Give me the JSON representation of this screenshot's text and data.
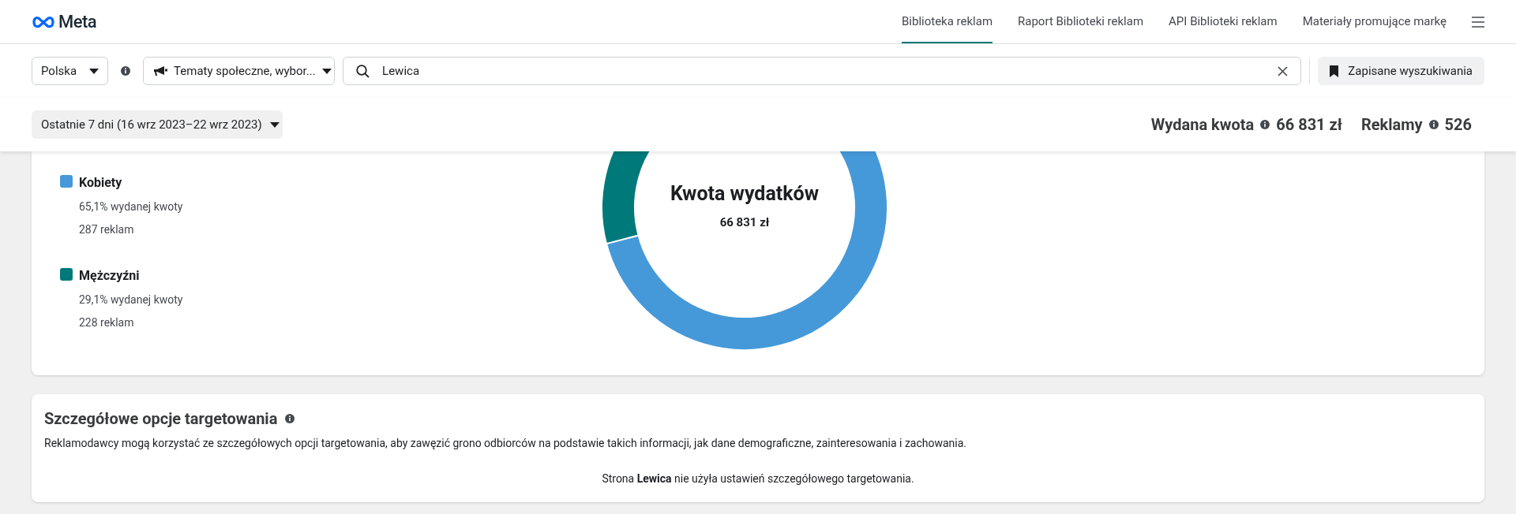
{
  "header": {
    "logo": "Meta",
    "nav": [
      {
        "label": "Biblioteka reklam",
        "selected": true
      },
      {
        "label": "Raport Biblioteki reklam",
        "selected": false
      },
      {
        "label": "API Biblioteki reklam",
        "selected": false
      },
      {
        "label": "Materiały promujące markę",
        "selected": false
      }
    ]
  },
  "filters": {
    "country": "Polska",
    "category": "Tematy społeczne, wybor...",
    "search": {
      "value": "Lewica"
    },
    "saved_button": "Zapisane wyszukiwania"
  },
  "summary": {
    "date_range": "Ostatnie 7 dni (16 wrz 2023–22 wrz 2023)",
    "spent_label": "Wydana kwota",
    "spent_value": "66 831 zł",
    "ads_label": "Reklamy",
    "ads_value": "526"
  },
  "gender_card": {
    "legend": [
      {
        "name": "Kobiety",
        "color": "#4599d8",
        "share": "65,1% wydanej kwoty",
        "ads": "287 reklam"
      },
      {
        "name": "Mężczyźni",
        "color": "#00797a",
        "share": "29,1% wydanej kwoty",
        "ads": "228 reklam"
      }
    ],
    "center_title": "Kwota wydatków",
    "center_value": "66 831 zł"
  },
  "targeting_card": {
    "title": "Szczegółowe opcje targetowania",
    "description": "Reklamodawcy mogą korzystać ze szczegółowych opcji targetowania, aby zawęzić grono odbiorców na podstawie takich informacji, jak dane demograficzne, zainteresowania i zachowania.",
    "note": "Strona **Lewica** nie użyła ustawień szczegółowego targetowania."
  }
}
